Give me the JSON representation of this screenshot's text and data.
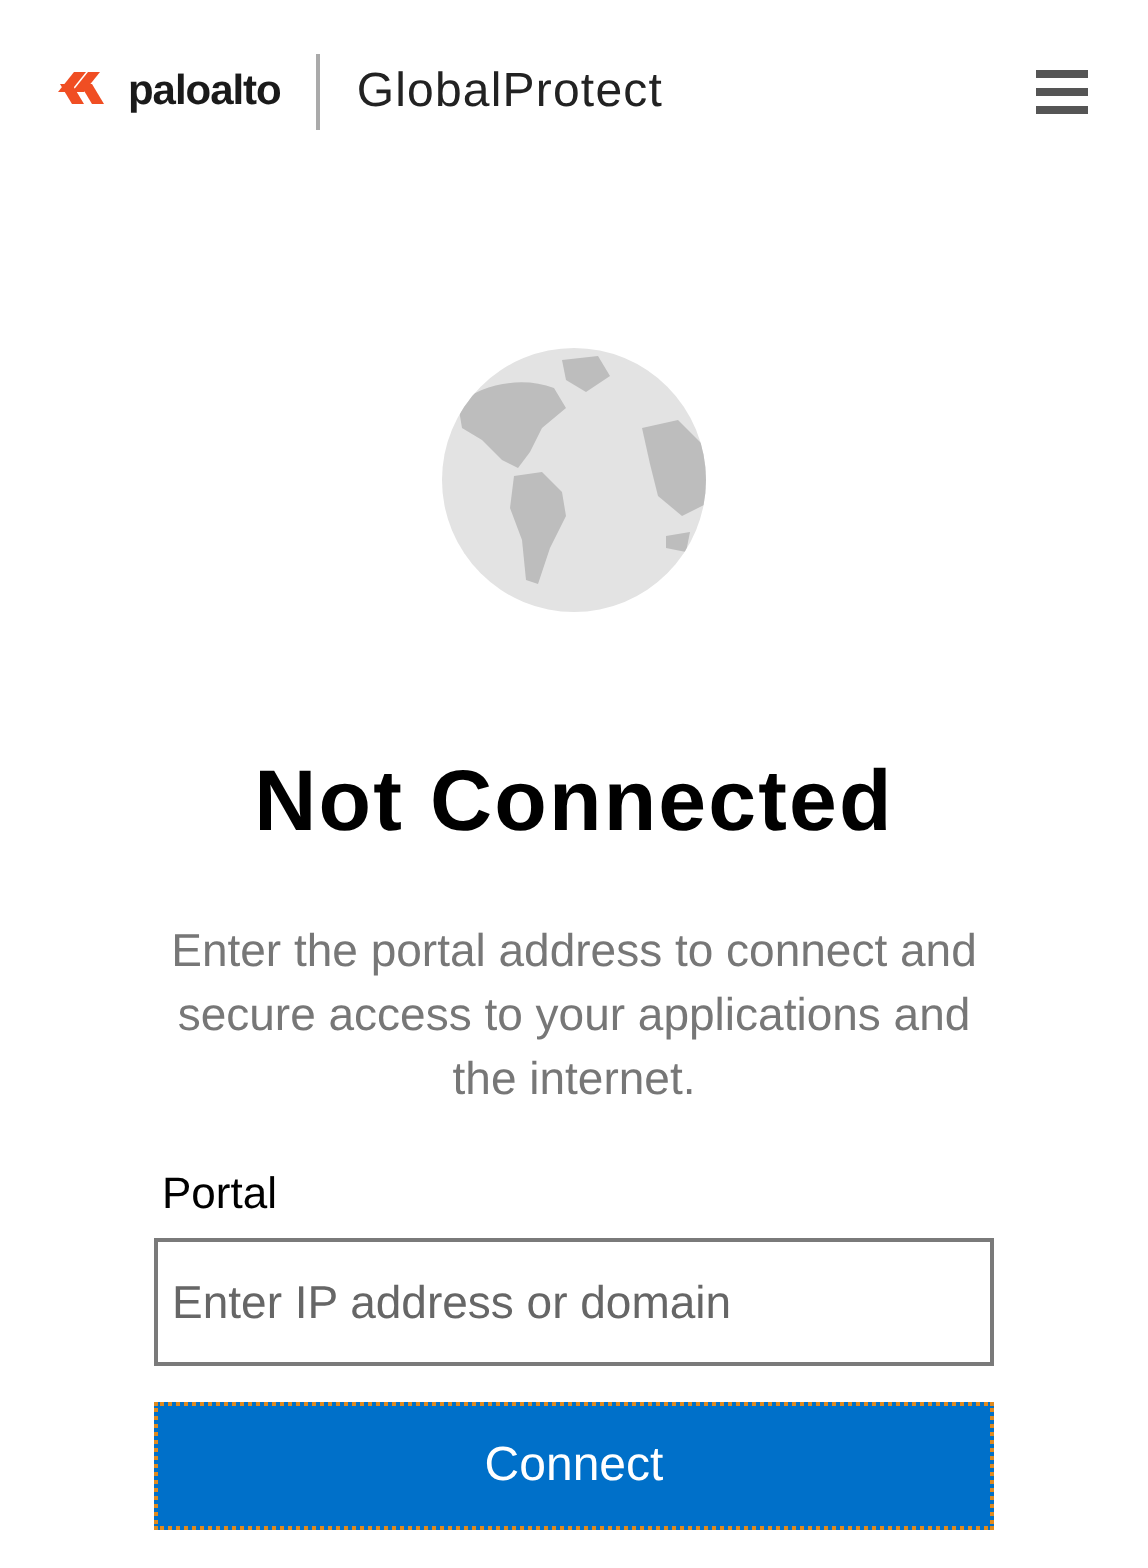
{
  "header": {
    "brand": "paloalto",
    "product": "GlobalProtect"
  },
  "status": {
    "title": "Not Connected",
    "message": "Enter the portal address to connect and secure access to your applications and the internet."
  },
  "portal": {
    "label": "Portal",
    "placeholder": "Enter IP address or domain"
  },
  "connect_button": {
    "label": "Connect",
    "focused": true
  }
}
